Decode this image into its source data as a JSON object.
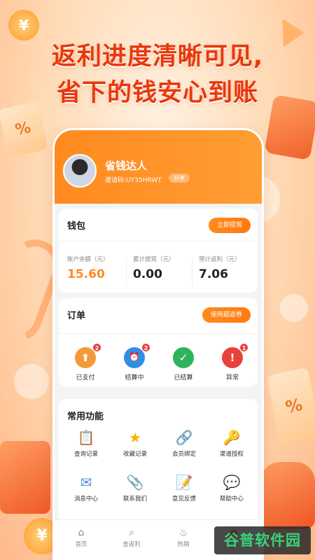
{
  "headline": {
    "line1": "返利进度清晰可见,",
    "line2": "省下的钱安心到账"
  },
  "profile": {
    "nickname": "省钱达人",
    "invite_code": "邀请码:UY35HRWT",
    "share_label": "分享"
  },
  "wallet": {
    "title": "钱包",
    "withdraw_label": "立即提现",
    "stats": [
      {
        "label": "账户余额（元）",
        "value": "15.60"
      },
      {
        "label": "累计提现（元）",
        "value": "0.00"
      },
      {
        "label": "预计返利（元）",
        "value": "7.06"
      }
    ]
  },
  "orders": {
    "title": "订单",
    "action_label": "使用超返券",
    "items": [
      {
        "label": "已支付",
        "icon": "upload-icon",
        "glyph": "⬆",
        "badge": "2",
        "color": "#f29a3a"
      },
      {
        "label": "结算中",
        "icon": "clock-icon",
        "glyph": "⏰",
        "badge": "2",
        "color": "#2f8fe8"
      },
      {
        "label": "已结算",
        "icon": "check-icon",
        "glyph": "✓",
        "badge": "",
        "color": "#2fb35a"
      },
      {
        "label": "异常",
        "icon": "alert-icon",
        "glyph": "!",
        "badge": "1",
        "color": "#e8413b"
      }
    ]
  },
  "functions": {
    "title": "常用功能",
    "items": [
      {
        "label": "查询记录",
        "icon": "clipboard-icon",
        "glyph": "📋"
      },
      {
        "label": "收藏记录",
        "icon": "star-icon",
        "glyph": "⭐"
      },
      {
        "label": "会员绑定",
        "icon": "link-icon",
        "glyph": "🔗"
      },
      {
        "label": "渠道授权",
        "icon": "key-icon",
        "glyph": "🔑"
      },
      {
        "label": "消息中心",
        "icon": "mail-icon",
        "glyph": "✉"
      },
      {
        "label": "联系我们",
        "icon": "paperclip-icon",
        "glyph": "📎"
      },
      {
        "label": "意见反馈",
        "icon": "memo-icon",
        "glyph": "📝"
      },
      {
        "label": "帮助中心",
        "icon": "chat-icon",
        "glyph": "💬"
      }
    ]
  },
  "tabbar": {
    "items": [
      {
        "label": "首页",
        "icon": "home-icon",
        "glyph": "⌂"
      },
      {
        "label": "查返利",
        "icon": "search-icon",
        "glyph": "⌕"
      },
      {
        "label": "热销",
        "icon": "flame-icon",
        "glyph": "♨"
      },
      {
        "label": "",
        "icon": "profile-icon",
        "glyph": "●"
      }
    ]
  },
  "watermark": "谷普软件园",
  "colors": {
    "accent": "#ff8a1f",
    "headline": "#e8380d",
    "badge": "#e8413b"
  }
}
